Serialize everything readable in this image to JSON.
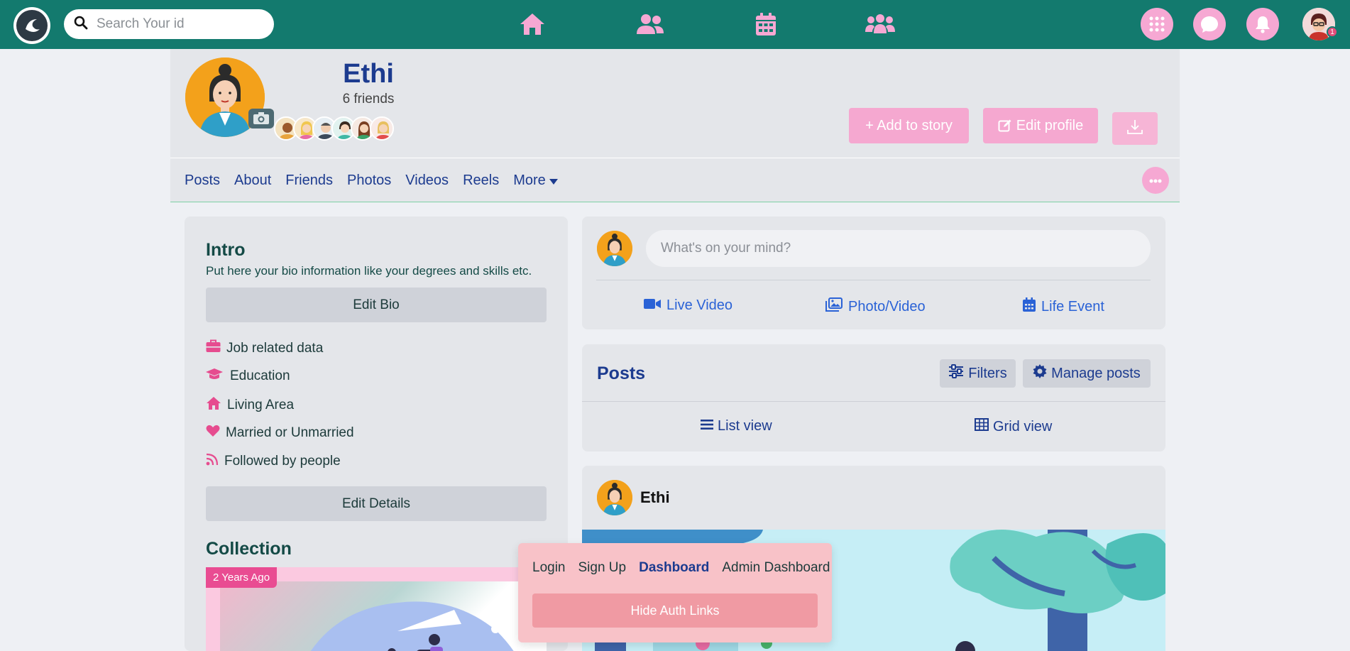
{
  "search": {
    "placeholder": "Search Your id"
  },
  "nav": {
    "center_icons": [
      "home-icon",
      "people-icon",
      "calendar-icon",
      "group-icon"
    ],
    "right_icons": [
      "apps-grid-icon",
      "messenger-icon",
      "bell-icon"
    ],
    "notification_badge": "1"
  },
  "profile": {
    "name": "Ethi",
    "friends": "6 friends",
    "add_story": "+ Add to story",
    "edit_profile": "Edit profile"
  },
  "tabs": {
    "posts": "Posts",
    "about": "About",
    "friends": "Friends",
    "photos": "Photos",
    "videos": "Videos",
    "reels": "Reels",
    "more": "More"
  },
  "intro": {
    "title": "Intro",
    "text": "Put here your bio information like your degrees and skills etc.",
    "edit_bio": "Edit Bio",
    "details": {
      "job": "Job related data",
      "education": "Education",
      "living": "Living Area",
      "married": "Married or Unmarried",
      "followed": "Followed by people"
    },
    "edit_details": "Edit Details",
    "collection_title": "Collection",
    "collection_badge": "2 Years Ago"
  },
  "composer": {
    "placeholder": "What's on your mind?",
    "live_video": "Live Video",
    "photo_video": "Photo/Video",
    "life_event": "Life Event"
  },
  "posts": {
    "title": "Posts",
    "filters": "Filters",
    "manage": "Manage posts",
    "list_view": "List view",
    "grid_view": "Grid view"
  },
  "post": {
    "author": "Ethi"
  },
  "auth": {
    "login": "Login",
    "signup": "Sign Up",
    "dashboard": "Dashboard",
    "admin": "Admin Dashboard",
    "hide": "Hide Auth Links"
  },
  "colors": {
    "nav_bg": "#137a6e",
    "accent_pink": "#f6a8d3",
    "link_blue": "#1c3b8f",
    "action_blue": "#2a62d6"
  }
}
